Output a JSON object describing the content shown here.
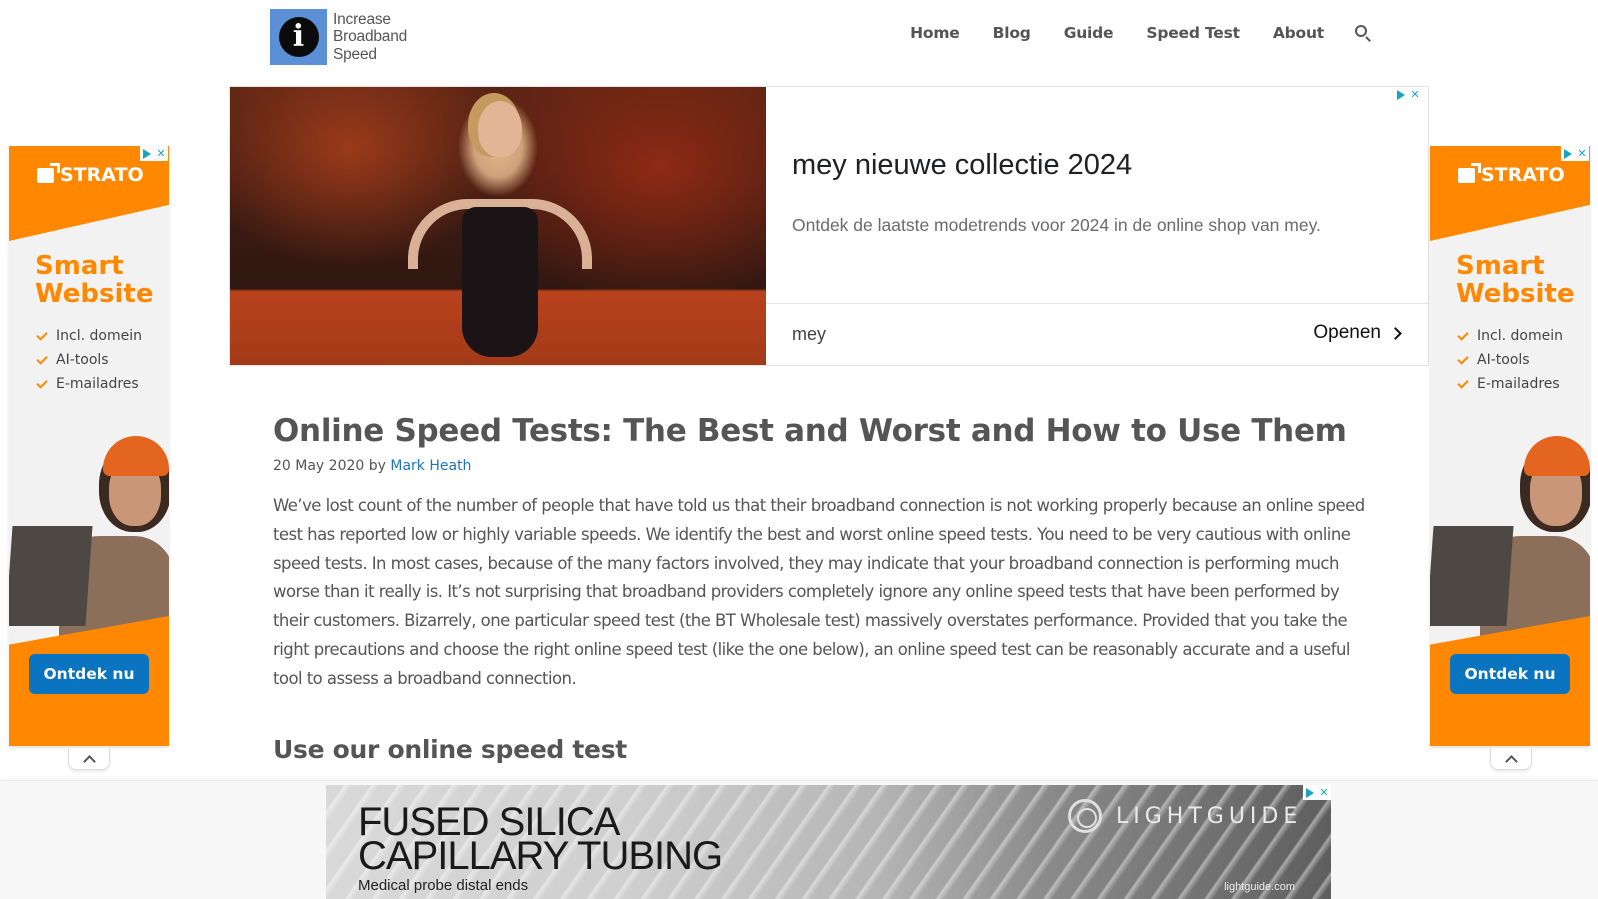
{
  "header": {
    "logo": {
      "icon_letter": "i",
      "lines": [
        "Increase",
        "Broadband",
        "Speed"
      ]
    },
    "nav": [
      {
        "label": "Home"
      },
      {
        "label": "Blog"
      },
      {
        "label": "Guide"
      },
      {
        "label": "Speed Test"
      },
      {
        "label": "About"
      }
    ],
    "search_icon": "search-icon"
  },
  "top_ad": {
    "headline": "mey nieuwe collectie 2024",
    "description": "Ontdek de laatste modetrends voor 2024 in de online shop van mey.",
    "brand": "mey",
    "cta": "Openen",
    "adchoices_icons": [
      "adchoices-icon",
      "close-icon"
    ],
    "close_glyph": "✕"
  },
  "side_ads": {
    "brand": "STRATO",
    "title_lines": [
      "Smart",
      "Website"
    ],
    "features": [
      "Incl. domein",
      "AI-tools",
      "E-mailadres"
    ],
    "cta": "Ontdek nu",
    "accent_color": "#ff8800",
    "button_color": "#0a74c0",
    "close_glyph": "✕"
  },
  "article": {
    "title": "Online Speed Tests: The Best and Worst and How to Use Them",
    "date": "20 May 2020",
    "by": "by",
    "author": "Mark Heath",
    "paragraph": "We’ve lost count of the number of people that have told us that their broadband connection is not working properly because an online speed test has reported low or highly variable speeds. We identify the best and worst online speed tests. You need to be very cautious with online speed tests. In most cases, because of the many factors involved, they may indicate that your broadband connection is performing much worse than it really is. It’s not surprising that broadband providers completely ignore any online speed tests that have been performed by their customers. Bizarrely, one particular speed test (the BT Wholesale test) massively overstates performance. Provided that you take the right precautions and choose the right online speed test (like the one below), an online speed test can be reasonably accurate and a useful tool to assess a broadband connection.",
    "section_heading": "Use our online speed test",
    "link_color": "#1e73be"
  },
  "bottom_ad": {
    "title_lines": [
      "FUSED SILICA",
      "CAPILLARY TUBING"
    ],
    "subtitle": "Medical probe distal ends",
    "brand": "LIGHTGUIDE",
    "url": "lightguide.com",
    "close_glyph": "✕"
  }
}
